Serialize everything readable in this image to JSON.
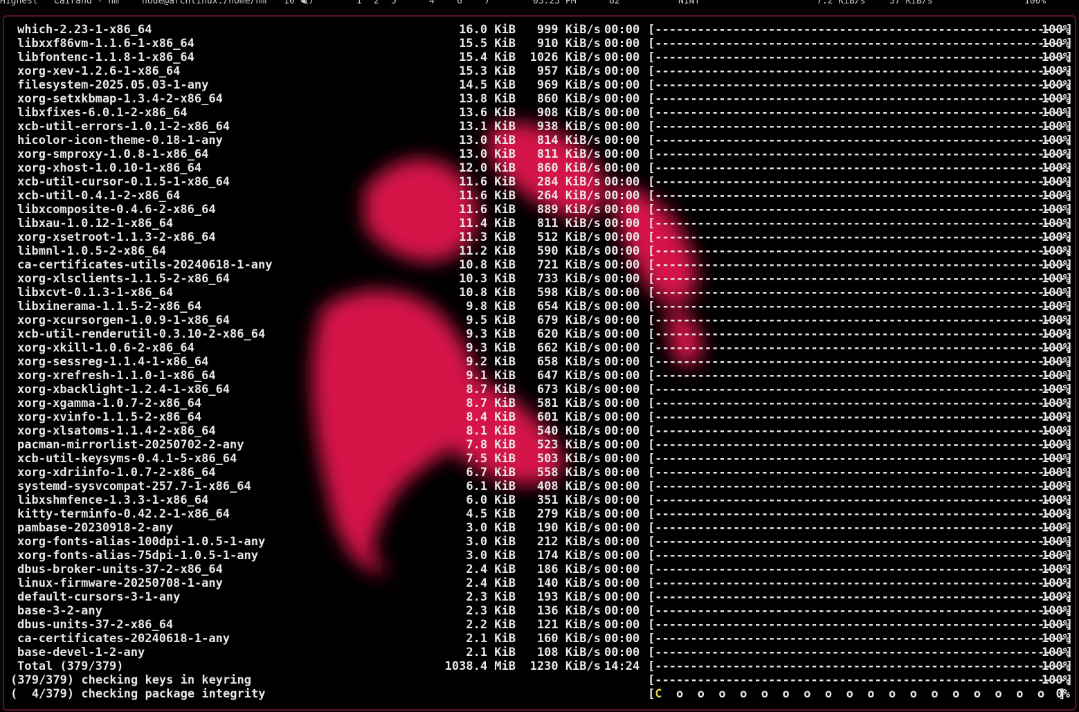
{
  "topbar": {
    "items": [
      "Highest",
      "Cairand - nm",
      "node@archlinux:/home/nm",
      "10 ◀",
      "17",
      "1",
      "2",
      "5",
      "4",
      "6",
      "7",
      "03:23 PM",
      "82",
      "NINT",
      "7.2 KiB/s",
      "37 KiB/s",
      "100%"
    ]
  },
  "colors": {
    "accent": "#e8194f",
    "border": "#5a1630",
    "text": "#e8e8e8",
    "yellow": "#e6d24a"
  },
  "downloads": [
    {
      "name": "which-2.23-1-x86_64",
      "size": "16.0 KiB",
      "rate": "999 KiB/s",
      "time": "00:00",
      "pct": "100%"
    },
    {
      "name": "libxxf86vm-1.1.6-1-x86_64",
      "size": "15.5 KiB",
      "rate": "910 KiB/s",
      "time": "00:00",
      "pct": "100%"
    },
    {
      "name": "libfontenc-1.1.8-1-x86_64",
      "size": "15.4 KiB",
      "rate": "1026 KiB/s",
      "time": "00:00",
      "pct": "100%"
    },
    {
      "name": "xorg-xev-1.2.6-1-x86_64",
      "size": "15.3 KiB",
      "rate": "957 KiB/s",
      "time": "00:00",
      "pct": "100%"
    },
    {
      "name": "filesystem-2025.05.03-1-any",
      "size": "14.5 KiB",
      "rate": "969 KiB/s",
      "time": "00:00",
      "pct": "100%"
    },
    {
      "name": "xorg-setxkbmap-1.3.4-2-x86_64",
      "size": "13.8 KiB",
      "rate": "860 KiB/s",
      "time": "00:00",
      "pct": "100%"
    },
    {
      "name": "libxfixes-6.0.1-2-x86_64",
      "size": "13.6 KiB",
      "rate": "908 KiB/s",
      "time": "00:00",
      "pct": "100%"
    },
    {
      "name": "xcb-util-errors-1.0.1-2-x86_64",
      "size": "13.1 KiB",
      "rate": "938 KiB/s",
      "time": "00:00",
      "pct": "100%"
    },
    {
      "name": "hicolor-icon-theme-0.18-1-any",
      "size": "13.0 KiB",
      "rate": "814 KiB/s",
      "time": "00:00",
      "pct": "100%"
    },
    {
      "name": "xorg-smproxy-1.0.8-1-x86_64",
      "size": "13.0 KiB",
      "rate": "811 KiB/s",
      "time": "00:00",
      "pct": "100%"
    },
    {
      "name": "xorg-xhost-1.0.10-1-x86_64",
      "size": "12.0 KiB",
      "rate": "860 KiB/s",
      "time": "00:00",
      "pct": "100%"
    },
    {
      "name": "xcb-util-cursor-0.1.5-1-x86_64",
      "size": "11.6 KiB",
      "rate": "284 KiB/s",
      "time": "00:00",
      "pct": "100%"
    },
    {
      "name": "xcb-util-0.4.1-2-x86_64",
      "size": "11.6 KiB",
      "rate": "264 KiB/s",
      "time": "00:00",
      "pct": "100%"
    },
    {
      "name": "libxcomposite-0.4.6-2-x86_64",
      "size": "11.6 KiB",
      "rate": "889 KiB/s",
      "time": "00:00",
      "pct": "100%"
    },
    {
      "name": "libxau-1.0.12-1-x86_64",
      "size": "11.4 KiB",
      "rate": "811 KiB/s",
      "time": "00:00",
      "pct": "100%"
    },
    {
      "name": "xorg-xsetroot-1.1.3-2-x86_64",
      "size": "11.3 KiB",
      "rate": "512 KiB/s",
      "time": "00:00",
      "pct": "100%"
    },
    {
      "name": "libmnl-1.0.5-2-x86_64",
      "size": "11.2 KiB",
      "rate": "590 KiB/s",
      "time": "00:00",
      "pct": "100%"
    },
    {
      "name": "ca-certificates-utils-20240618-1-any",
      "size": "10.8 KiB",
      "rate": "721 KiB/s",
      "time": "00:00",
      "pct": "100%"
    },
    {
      "name": "xorg-xlsclients-1.1.5-2-x86_64",
      "size": "10.3 KiB",
      "rate": "733 KiB/s",
      "time": "00:00",
      "pct": "100%"
    },
    {
      "name": "libxcvt-0.1.3-1-x86_64",
      "size": "10.8 KiB",
      "rate": "598 KiB/s",
      "time": "00:00",
      "pct": "100%"
    },
    {
      "name": "libxinerama-1.1.5-2-x86_64",
      "size": "9.8 KiB",
      "rate": "654 KiB/s",
      "time": "00:00",
      "pct": "100%"
    },
    {
      "name": "xorg-xcursorgen-1.0.9-1-x86_64",
      "size": "9.5 KiB",
      "rate": "679 KiB/s",
      "time": "00:00",
      "pct": "100%"
    },
    {
      "name": "xcb-util-renderutil-0.3.10-2-x86_64",
      "size": "9.3 KiB",
      "rate": "620 KiB/s",
      "time": "00:00",
      "pct": "100%"
    },
    {
      "name": "xorg-xkill-1.0.6-2-x86_64",
      "size": "9.3 KiB",
      "rate": "662 KiB/s",
      "time": "00:00",
      "pct": "100%"
    },
    {
      "name": "xorg-sessreg-1.1.4-1-x86_64",
      "size": "9.2 KiB",
      "rate": "658 KiB/s",
      "time": "00:00",
      "pct": "100%"
    },
    {
      "name": "xorg-xrefresh-1.1.0-1-x86_64",
      "size": "9.1 KiB",
      "rate": "647 KiB/s",
      "time": "00:00",
      "pct": "100%"
    },
    {
      "name": "xorg-xbacklight-1.2.4-1-x86_64",
      "size": "8.7 KiB",
      "rate": "673 KiB/s",
      "time": "00:00",
      "pct": "100%"
    },
    {
      "name": "xorg-xgamma-1.0.7-2-x86_64",
      "size": "8.7 KiB",
      "rate": "581 KiB/s",
      "time": "00:00",
      "pct": "100%"
    },
    {
      "name": "xorg-xvinfo-1.1.5-2-x86_64",
      "size": "8.4 KiB",
      "rate": "601 KiB/s",
      "time": "00:00",
      "pct": "100%"
    },
    {
      "name": "xorg-xlsatoms-1.1.4-2-x86_64",
      "size": "8.1 KiB",
      "rate": "540 KiB/s",
      "time": "00:00",
      "pct": "100%"
    },
    {
      "name": "pacman-mirrorlist-20250702-2-any",
      "size": "7.8 KiB",
      "rate": "523 KiB/s",
      "time": "00:00",
      "pct": "100%"
    },
    {
      "name": "xcb-util-keysyms-0.4.1-5-x86_64",
      "size": "7.5 KiB",
      "rate": "503 KiB/s",
      "time": "00:00",
      "pct": "100%"
    },
    {
      "name": "xorg-xdriinfo-1.0.7-2-x86_64",
      "size": "6.7 KiB",
      "rate": "558 KiB/s",
      "time": "00:00",
      "pct": "100%"
    },
    {
      "name": "systemd-sysvcompat-257.7-1-x86_64",
      "size": "6.1 KiB",
      "rate": "408 KiB/s",
      "time": "00:00",
      "pct": "100%"
    },
    {
      "name": "libxshmfence-1.3.3-1-x86_64",
      "size": "6.0 KiB",
      "rate": "351 KiB/s",
      "time": "00:00",
      "pct": "100%"
    },
    {
      "name": "kitty-terminfo-0.42.2-1-x86_64",
      "size": "4.5 KiB",
      "rate": "279 KiB/s",
      "time": "00:00",
      "pct": "100%"
    },
    {
      "name": "pambase-20230918-2-any",
      "size": "3.0 KiB",
      "rate": "190 KiB/s",
      "time": "00:00",
      "pct": "100%"
    },
    {
      "name": "xorg-fonts-alias-100dpi-1.0.5-1-any",
      "size": "3.0 KiB",
      "rate": "212 KiB/s",
      "time": "00:00",
      "pct": "100%"
    },
    {
      "name": "xorg-fonts-alias-75dpi-1.0.5-1-any",
      "size": "3.0 KiB",
      "rate": "174 KiB/s",
      "time": "00:00",
      "pct": "100%"
    },
    {
      "name": "dbus-broker-units-37-2-x86_64",
      "size": "2.4 KiB",
      "rate": "186 KiB/s",
      "time": "00:00",
      "pct": "100%"
    },
    {
      "name": "linux-firmware-20250708-1-any",
      "size": "2.4 KiB",
      "rate": "140 KiB/s",
      "time": "00:00",
      "pct": "100%"
    },
    {
      "name": "default-cursors-3-1-any",
      "size": "2.3 KiB",
      "rate": "193 KiB/s",
      "time": "00:00",
      "pct": "100%"
    },
    {
      "name": "base-3-2-any",
      "size": "2.3 KiB",
      "rate": "136 KiB/s",
      "time": "00:00",
      "pct": "100%"
    },
    {
      "name": "dbus-units-37-2-x86_64",
      "size": "2.2 KiB",
      "rate": "121 KiB/s",
      "time": "00:00",
      "pct": "100%"
    },
    {
      "name": "ca-certificates-20240618-1-any",
      "size": "2.1 KiB",
      "rate": "160 KiB/s",
      "time": "00:00",
      "pct": "100%"
    },
    {
      "name": "base-devel-1-2-any",
      "size": "2.1 KiB",
      "rate": "108 KiB/s",
      "time": "00:00",
      "pct": "100%"
    }
  ],
  "total": {
    "name": "Total (379/379)",
    "size": "1038.4 MiB",
    "rate": "1230 KiB/s",
    "time": "14:24",
    "pct": "100%"
  },
  "status_lines": [
    {
      "text": "(379/379) checking keys in keyring",
      "pct": "100%",
      "progress": 1.0
    },
    {
      "text": "(  4/379) checking package integrity",
      "pct": "0%",
      "progress": 0.0
    }
  ],
  "progress_bar_full": "[----------------------------------------------------------]",
  "progress_bar_pacman": "[C  o  o  o  o  o  o  o  o  o  o  o  o  o  o  o  o  o  o  ]"
}
